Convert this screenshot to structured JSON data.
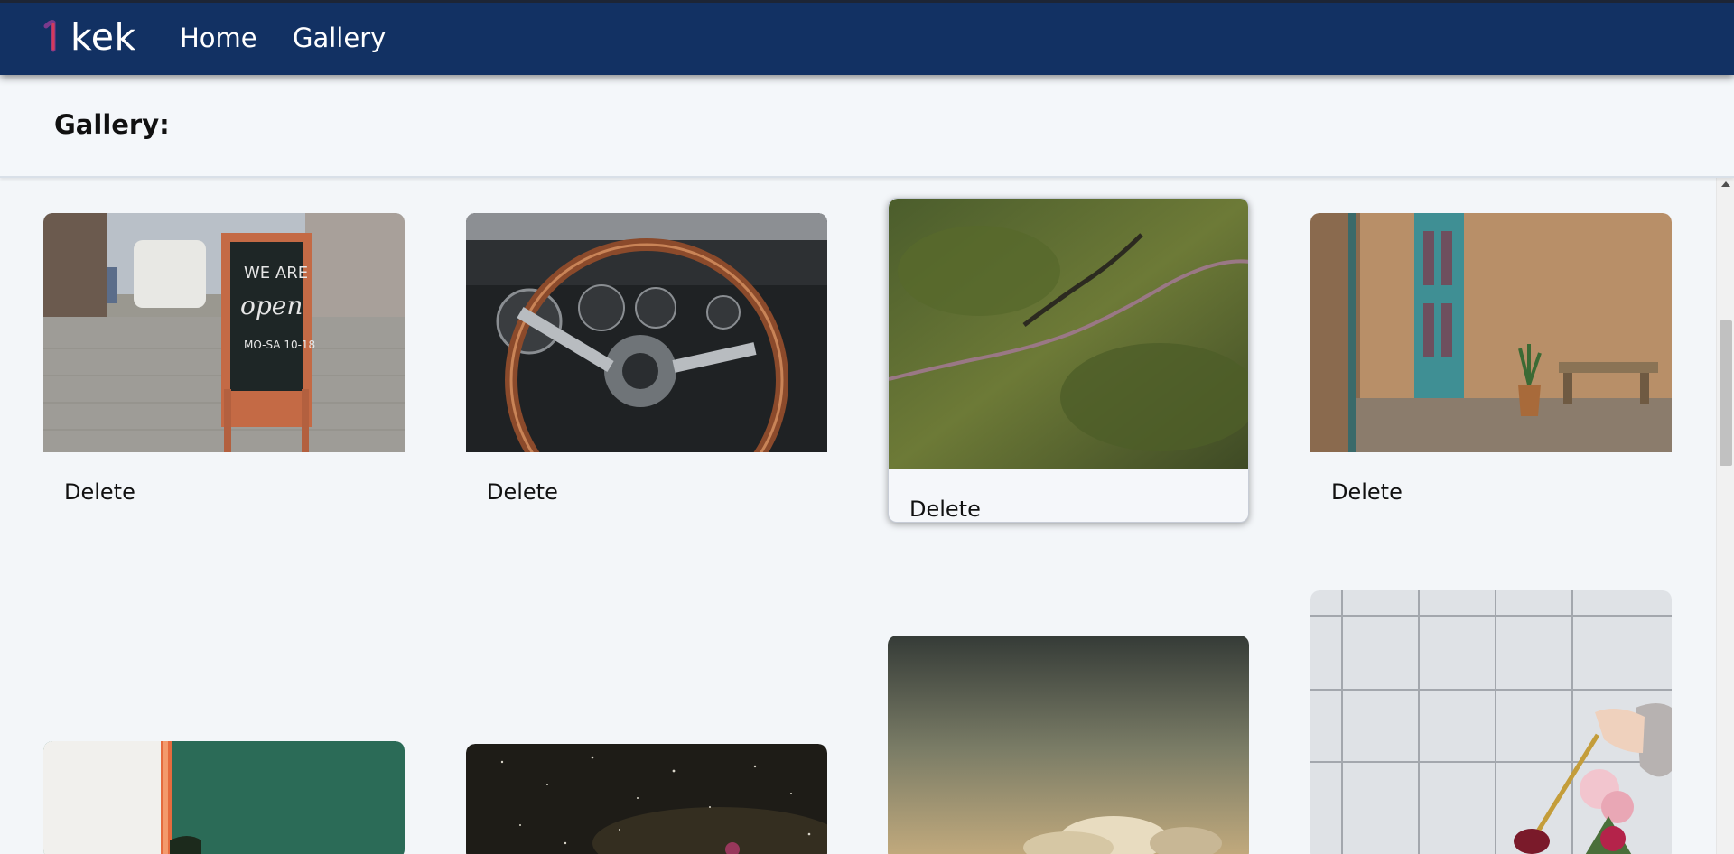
{
  "app": {
    "brand": "kek"
  },
  "nav": {
    "home_label": "Home",
    "gallery_label": "Gallery"
  },
  "page": {
    "title": "Gallery:"
  },
  "cards": [
    {
      "delete_label": "Delete",
      "image": "chalkboard-sign-we-are-open"
    },
    {
      "delete_label": "Delete",
      "image": "car-steering-wheel"
    },
    {
      "delete_label": "Delete",
      "image": "aerial-green-valley"
    },
    {
      "delete_label": "Delete",
      "image": "teal-door-courtyard"
    },
    {
      "image": "green-wall-film"
    },
    {
      "image": "starry-night-sky"
    },
    {
      "image": "cloudy-sunset"
    },
    {
      "image": "hand-with-flowers"
    }
  ],
  "colors": {
    "navbar": "#123163",
    "background": "#f3f6f9"
  }
}
